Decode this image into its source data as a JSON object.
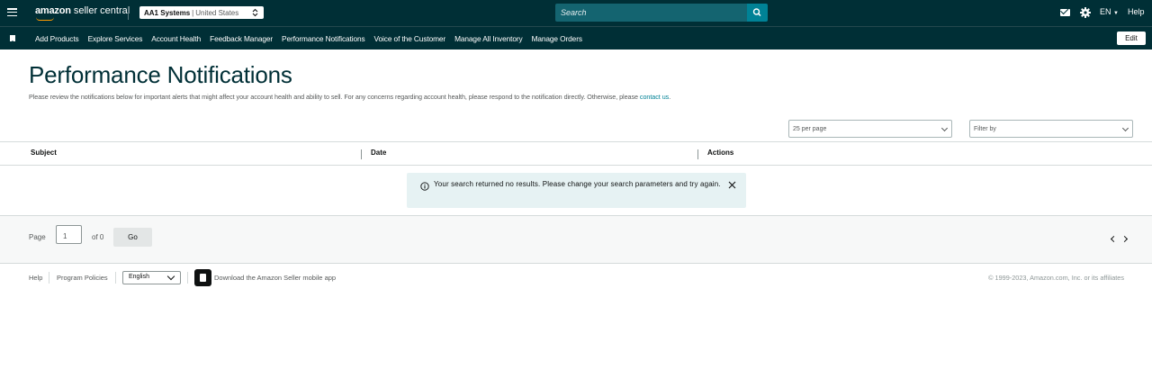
{
  "header": {
    "logo_brand": "amazon",
    "logo_product": "seller central",
    "account_name": "AA1 Systems",
    "marketplace": "United States",
    "search_placeholder": "Search",
    "language": "EN",
    "help_label": "Help",
    "icons": [
      "menu-icon",
      "mail-icon",
      "gear-icon",
      "search-icon"
    ]
  },
  "nav": {
    "links": [
      "Add Products",
      "Explore Services",
      "Account Health",
      "Feedback Manager",
      "Performance Notifications",
      "Voice of the Customer",
      "Manage All Inventory",
      "Manage Orders"
    ],
    "edit_label": "Edit"
  },
  "page": {
    "title": "Performance Notifications",
    "description": "Please review the notifications below for important alerts that might affect your account health and ability to sell. For any concerns regarding account health, please respond to the notification directly. Otherwise, please",
    "contact_link": "contact us",
    "description_end": "."
  },
  "controls": {
    "per_page": "25 per page",
    "filter_placeholder": "Filter by"
  },
  "table": {
    "columns": [
      "Subject",
      "Date",
      "Actions"
    ],
    "rows": [],
    "empty_message": "Your search returned no results. Please change your search parameters and try again."
  },
  "pagination": {
    "page_label": "Page",
    "current_page": "1",
    "of_label": "of 0",
    "go_label": "Go"
  },
  "footer": {
    "help": "Help",
    "program_policies": "Program Policies",
    "language": "English",
    "app_text": "Download the Amazon Seller mobile app",
    "copyright": "© 1999-2023, Amazon.com, Inc. or its affiliates"
  },
  "colors": {
    "header_bg": "#002f36",
    "accent": "#008296",
    "alert_bg": "#e6f2f3",
    "logo_smile": "#ff9900"
  }
}
